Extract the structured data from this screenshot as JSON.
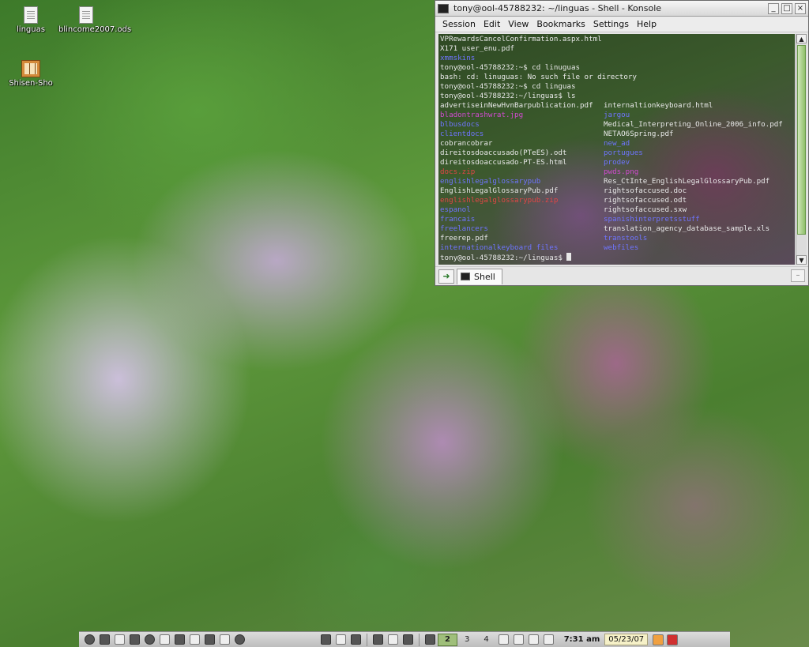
{
  "desktop": {
    "icons": [
      {
        "label": "linguas"
      },
      {
        "label": "blincome2007.ods"
      },
      {
        "label": "Shisen-Sho"
      }
    ]
  },
  "window": {
    "title": "tony@ool-45788232: ~/linguas - Shell - Konsole",
    "menu": [
      "Session",
      "Edit",
      "View",
      "Bookmarks",
      "Settings",
      "Help"
    ],
    "tab_label": "Shell"
  },
  "terminal": {
    "pre_lines": [
      "VPRewardsCancelConfirmation.aspx.html",
      "X171 user_enu.pdf",
      "xmmskins",
      "tony@ool-45788232:~$ cd linuguas",
      "bash: cd: linuguas: No such file or directory",
      "tony@ool-45788232:~$ cd linguas",
      "tony@ool-45788232:~/linguas$ ls"
    ],
    "pre_line_kinds": [
      "file",
      "file",
      "dir",
      "file",
      "file",
      "file",
      "file"
    ],
    "ls_rows": [
      [
        {
          "t": "advertiseinNewHvnBarpublication.pdf",
          "k": "file"
        },
        {
          "t": "internaltionkeyboard.html",
          "k": "file"
        }
      ],
      [
        {
          "t": "bladontrashwrat.jpg",
          "k": "img"
        },
        {
          "t": "jargou",
          "k": "dir"
        }
      ],
      [
        {
          "t": "blbusdocs",
          "k": "dir"
        },
        {
          "t": "Medical_Interpreting_Online_2006_info.pdf",
          "k": "file"
        }
      ],
      [
        {
          "t": "clientdocs",
          "k": "dir"
        },
        {
          "t": "NETAO6Spring.pdf",
          "k": "file"
        }
      ],
      [
        {
          "t": "cobrancobrar",
          "k": "file"
        },
        {
          "t": "new_ad",
          "k": "dir"
        }
      ],
      [
        {
          "t": "direitosdoaccusado(PTeES).odt",
          "k": "file"
        },
        {
          "t": "portugues",
          "k": "dir"
        }
      ],
      [
        {
          "t": "direitosdoaccusado-PT-ES.html",
          "k": "file"
        },
        {
          "t": "prodev",
          "k": "dir"
        }
      ],
      [
        {
          "t": "docs.zip",
          "k": "arc"
        },
        {
          "t": "pwds.png",
          "k": "img"
        }
      ],
      [
        {
          "t": "englishlegalglossarypub",
          "k": "dir"
        },
        {
          "t": "Res_CtInte_EnglishLegalGlossaryPub.pdf",
          "k": "file"
        }
      ],
      [
        {
          "t": "EnglishLegalGlossaryPub.pdf",
          "k": "file"
        },
        {
          "t": "rightsofaccused.doc",
          "k": "file"
        }
      ],
      [
        {
          "t": "englishlegalglossarypub.zip",
          "k": "arc"
        },
        {
          "t": "rightsofaccused.odt",
          "k": "file"
        }
      ],
      [
        {
          "t": "espanol",
          "k": "dir"
        },
        {
          "t": "rightsofaccused.sxw",
          "k": "file"
        }
      ],
      [
        {
          "t": "francais",
          "k": "dir"
        },
        {
          "t": "spanishinterpretsstuff",
          "k": "dir"
        }
      ],
      [
        {
          "t": "freelancers",
          "k": "dir"
        },
        {
          "t": "translation_agency_database_sample.xls",
          "k": "file"
        }
      ],
      [
        {
          "t": "freerep.pdf",
          "k": "file"
        },
        {
          "t": "transtools",
          "k": "dir"
        }
      ],
      [
        {
          "t": "internationalkeyboard files",
          "k": "dir"
        },
        {
          "t": "webfiles",
          "k": "dir"
        }
      ]
    ],
    "prompt": "tony@ool-45788232:~/linguas$ ",
    "colors": {
      "dir": "#6f74ff",
      "img": "#d24bd2",
      "arc": "#e24646",
      "file": "#e8e8e8"
    }
  },
  "taskbar": {
    "desktops": [
      "2",
      "3",
      "4"
    ],
    "active_desktop": "2",
    "time": "7:31 am",
    "date": "05/23/07"
  }
}
